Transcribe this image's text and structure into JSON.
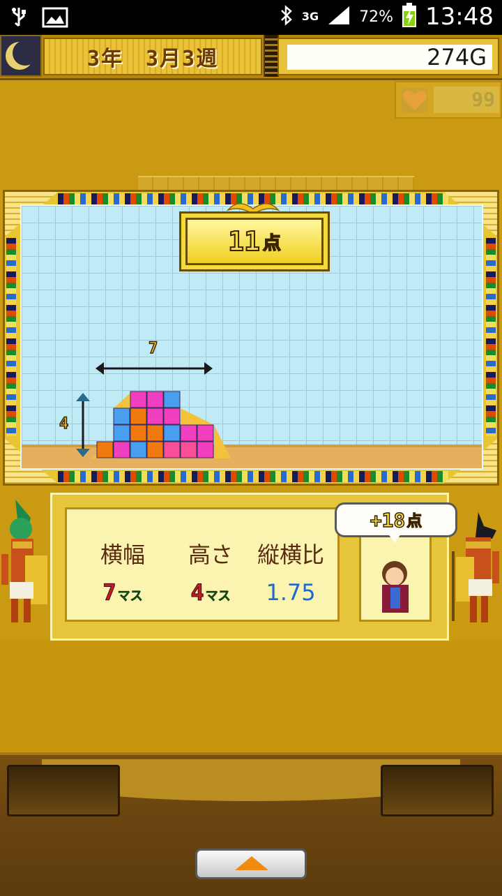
{
  "status_bar": {
    "network": "3G",
    "battery_percent": "72%",
    "time": "13:48"
  },
  "hud": {
    "date": "3年　3月3週",
    "gold": "274G",
    "hearts": "99"
  },
  "game": {
    "score_value": "11",
    "score_unit": "点",
    "width_marker": "7",
    "height_marker": "4"
  },
  "results": {
    "width_title": "横幅",
    "height_title": "高さ",
    "ratio_title": "縦横比",
    "width_value": "7",
    "width_unit": "マス",
    "height_value": "4",
    "height_unit": "マス",
    "ratio_value": "1.75"
  },
  "bonus": {
    "value": "+18",
    "unit": "点"
  },
  "colors": {
    "orange": "#f07a10",
    "pink": "#f040c0",
    "blue": "#4a9ef0",
    "magenta": "#f85098"
  }
}
